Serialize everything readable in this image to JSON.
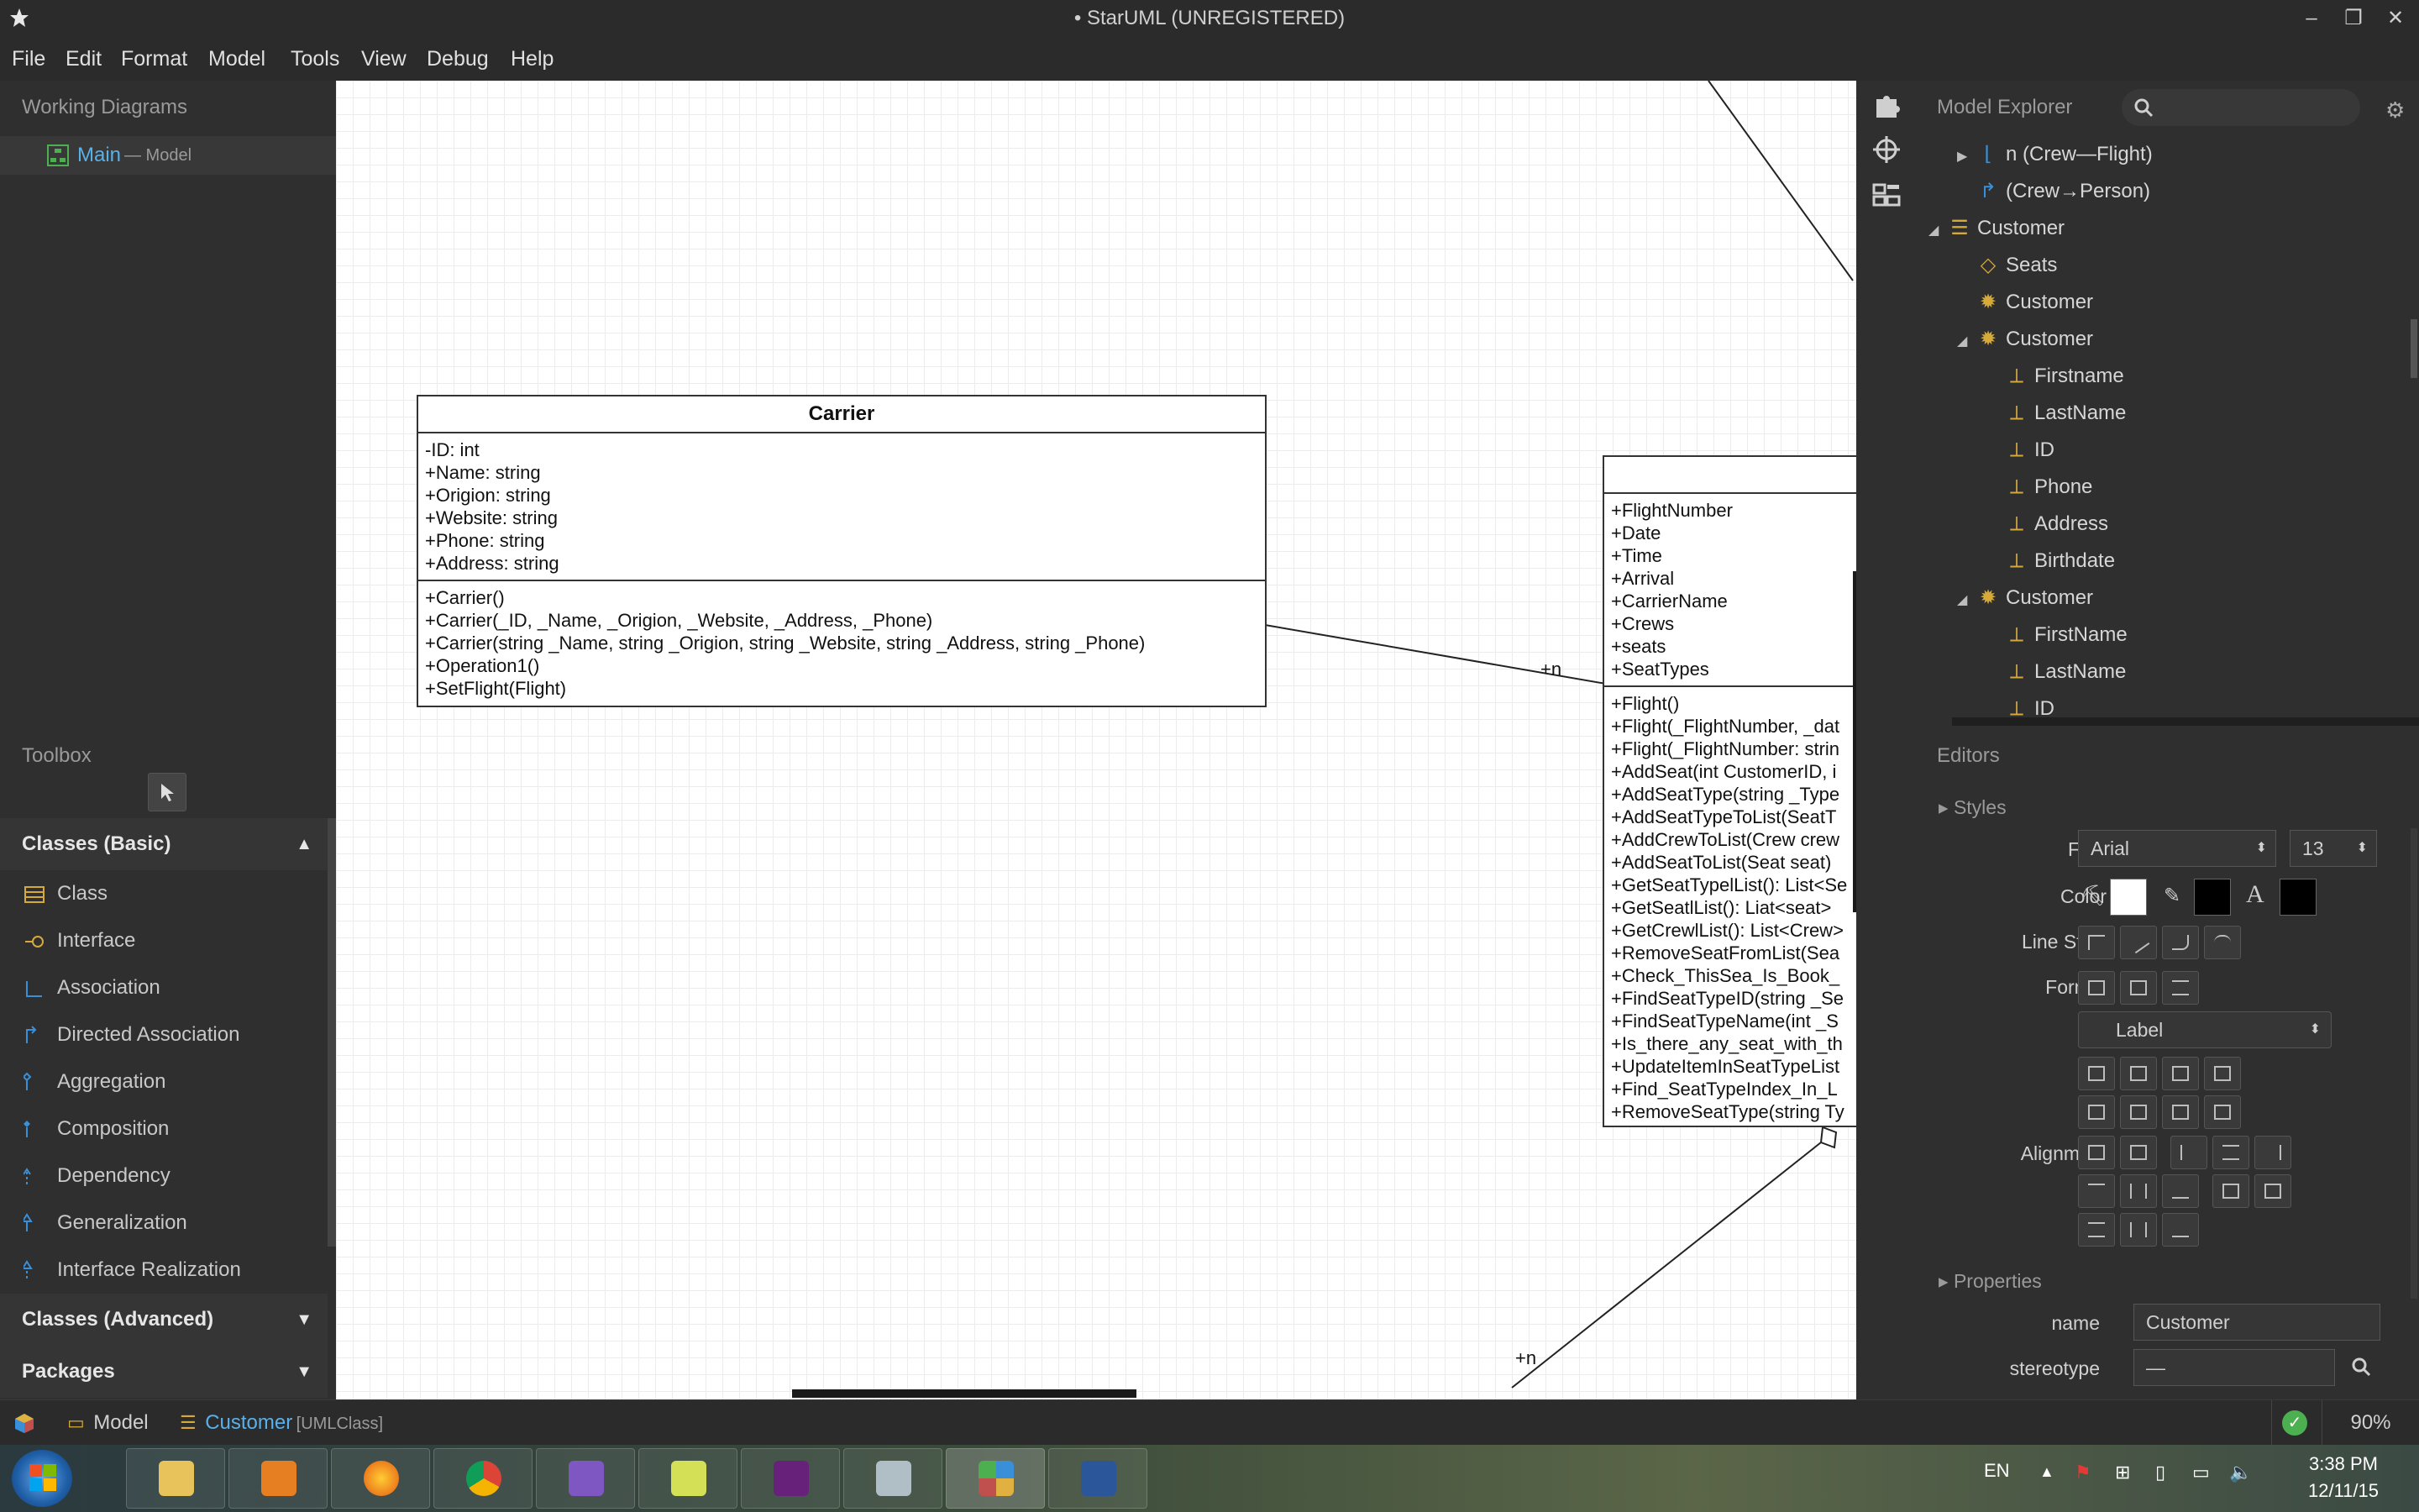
{
  "app": {
    "title": "• StarUML (UNREGISTERED)"
  },
  "menu": [
    "File",
    "Edit",
    "Format",
    "Model",
    "Tools",
    "View",
    "Debug",
    "Help"
  ],
  "working_diagrams": {
    "title": "Working Diagrams",
    "item_name": "Main",
    "item_suffix": "— Model"
  },
  "toolbox": {
    "title": "Toolbox",
    "section_basic": "Classes (Basic)",
    "items": [
      "Class",
      "Interface",
      "Association",
      "Directed Association",
      "Aggregation",
      "Composition",
      "Dependency",
      "Generalization",
      "Interface Realization"
    ],
    "section_advanced": "Classes (Advanced)",
    "section_packages": "Packages"
  },
  "canvas": {
    "carrier": {
      "name": "Carrier",
      "attributes": [
        "-ID: int",
        "+Name: string",
        "+Origion: string",
        "+Website: string",
        "+Phone: string",
        "+Address: string"
      ],
      "operations": [
        "+Carrier()",
        "+Carrier(_ID, _Name, _Origion, _Website, _Address, _Phone)",
        "+Carrier(string _Name, string _Origion, string _Website, string _Address, string _Phone)",
        "+Operation1()",
        "+SetFlight(Flight)"
      ]
    },
    "flight": {
      "attributes": [
        "+FlightNumber",
        "+Date",
        "+Time",
        "+Arrival",
        "+CarrierName",
        "+Crews",
        "+seats",
        "+SeatTypes"
      ],
      "operations": [
        "+Flight()",
        "+Flight(_FlightNumber, _dat",
        "+Flight(_FlightNumber: strin",
        "+AddSeat(int CustomerID, i",
        "+AddSeatType(string _Type",
        "+AddSeatTypeToList(SeatT",
        "+AddCrewToList(Crew crew",
        "+AddSeatToList(Seat seat)",
        "+GetSeatTypelList(): List<Se",
        "+GetSeatlList(): Liat<seat>",
        "+GetCrewlList(): List<Crew>",
        "+RemoveSeatFromList(Sea",
        "+Check_ThisSea_Is_Book_",
        "+FindSeatTypeID(string _Se",
        "+FindSeatTypeName(int _S",
        "+Is_there_any_seat_with_th",
        "+UpdateItemInSeatTypeList",
        "+Find_SeatTypeIndex_In_L",
        "+RemoveSeatType(string Ty"
      ]
    },
    "mult_1": "+n",
    "mult_2": "+n"
  },
  "explorer": {
    "title": "Model Explorer",
    "search_placeholder": "",
    "rows": [
      "n (Crew—Flight)",
      "(Crew→Person)",
      "Customer",
      "Seats",
      "Customer",
      "Customer",
      "Firstname",
      "LastName",
      "ID",
      "Phone",
      "Address",
      "Birthdate",
      "Customer",
      "FirstName",
      "LastName",
      "ID"
    ]
  },
  "editors": {
    "title": "Editors",
    "styles": "Styles",
    "font_label": "Font",
    "font_value": "Arial",
    "font_size": "13",
    "color_label": "Color",
    "line_style_label": "Line Style",
    "format_label": "Format",
    "format_value": "Label",
    "alignment_label": "Alignment",
    "properties": "Properties",
    "name_label": "name",
    "name_value": "Customer",
    "stereotype_label": "stereotype",
    "stereotype_value": "—"
  },
  "statusbar": {
    "crumb_model": "Model",
    "crumb_customer": "Customer",
    "crumb_type": "[UMLClass]",
    "zoom": "90%"
  },
  "taskbar": {
    "lang": "EN",
    "time": "3:38 PM",
    "date": "12/11/15"
  }
}
